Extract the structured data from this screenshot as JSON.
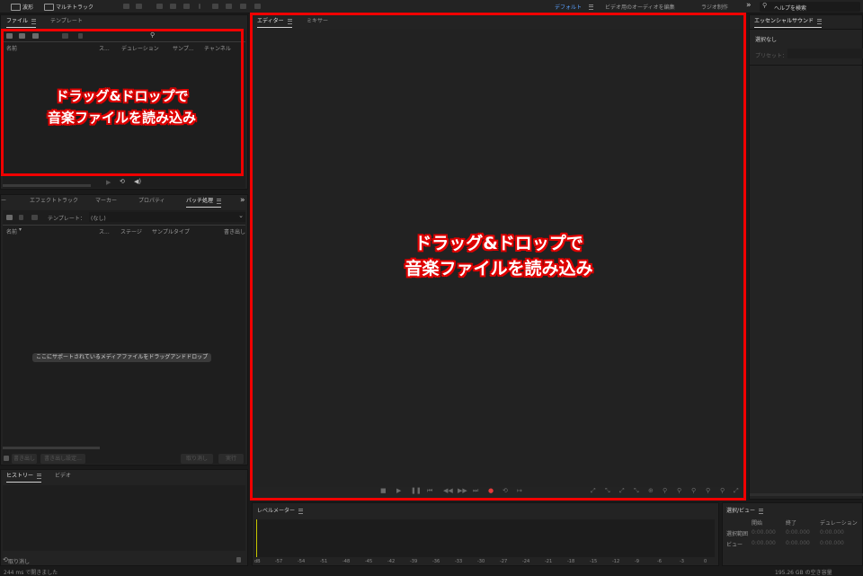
{
  "toolbar": {
    "waveform": "波形",
    "multitrack": "マルチトラック",
    "workspaces": [
      "デフォルト",
      "ビデオ用のオーディオを編集",
      "ラジオ制作"
    ],
    "more": "»",
    "help_placeholder": "ヘルプを検索"
  },
  "files_panel": {
    "tabs": [
      "ファイル",
      "テンプレート"
    ],
    "columns": [
      "名前",
      "ス...",
      "デュレーション",
      "サンプ...",
      "チャンネル"
    ]
  },
  "effects_panel": {
    "tabs": [
      "エフェクトトラック",
      "マーカー",
      "プロパティ",
      "バッチ処理"
    ],
    "more": "»",
    "template_label": "テンプレート：",
    "template_value": "(なし)",
    "columns": [
      "名前",
      "ス...",
      "ステージ",
      "サンプルタイプ",
      "書き出し"
    ],
    "drop_hint": "ここにサポートされているメディアファイルをドラッグアンドドロップ",
    "buttons": [
      "書き出し",
      "書き出し設定...",
      "取り消し",
      "実行"
    ]
  },
  "history_panel": {
    "tabs": [
      "ヒストリー",
      "ビデオ"
    ],
    "undo": "取り消し",
    "status": "244 ms で開きました"
  },
  "editor_panel": {
    "tabs": [
      "エディター",
      "ミキサー"
    ]
  },
  "essential_panel": {
    "title": "エッセンシャルサウンド",
    "selection": "選択なし",
    "preset_label": "プリセット："
  },
  "level_panel": {
    "title": "レベルメーター",
    "scale": [
      "dB",
      "-57",
      "-54",
      "-51",
      "-48",
      "-45",
      "-42",
      "-39",
      "-36",
      "-33",
      "-30",
      "-27",
      "-24",
      "-21",
      "-18",
      "-15",
      "-12",
      "-9",
      "-6",
      "-3",
      "0"
    ]
  },
  "selection_panel": {
    "title": "選択/ビュー",
    "col_start": "開始",
    "col_end": "終了",
    "col_duration": "デュレーション",
    "row_selection": "選択範囲",
    "row_view": "ビュー",
    "zero": "0:00.000",
    "disk": "195.26 GB の空き容量"
  },
  "annotations": {
    "small_line1": "ドラッグ&ドロップで",
    "small_line2": "音楽ファイルを読み込み",
    "large_line1": "ドラッグ&ドロップで",
    "large_line2": "音楽ファイルを読み込み",
    "color": "#f00000"
  }
}
